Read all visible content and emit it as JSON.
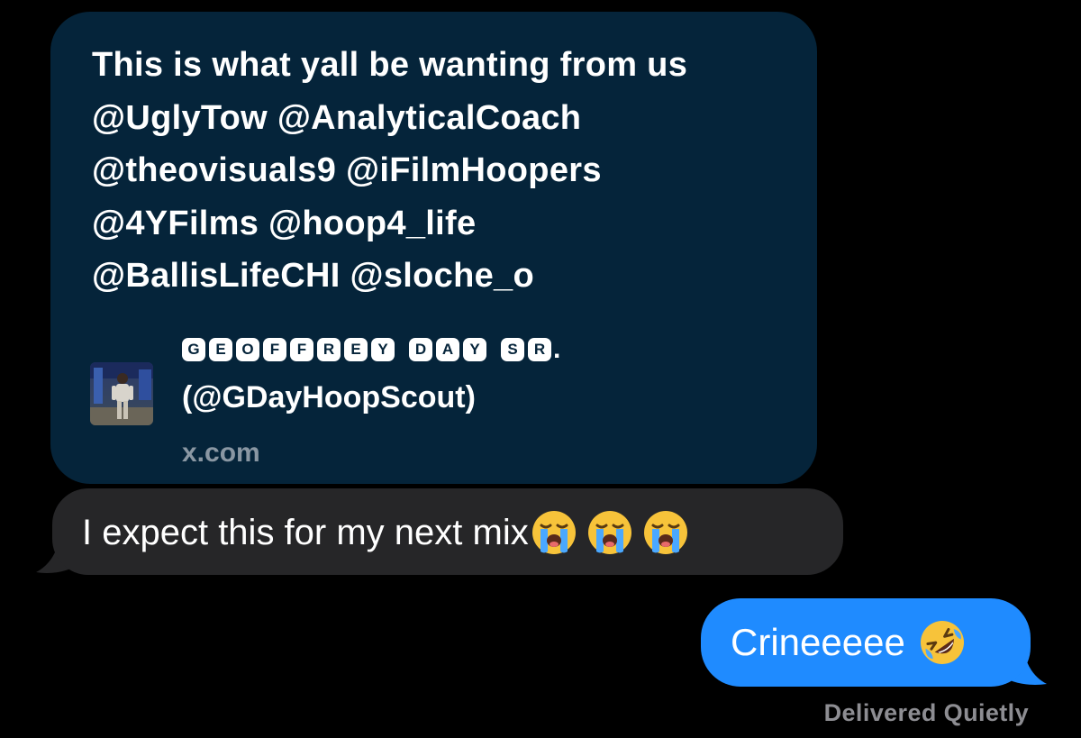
{
  "conversation": {
    "link_message": {
      "text_lines": [
        "This is what yall be wanting from us",
        "@UglyTow @AnalyticalCoach",
        "@theovisuals9 @iFilmHoopers",
        "@4YFilms @hoop4_life",
        "@BallisLifeCHI @sloche_o"
      ],
      "preview": {
        "author_name_letters": [
          [
            "G",
            "E",
            "O",
            "F",
            "F",
            "R",
            "E",
            "Y"
          ],
          [
            "D",
            "A",
            "Y"
          ],
          [
            "S",
            "R"
          ]
        ],
        "author_name_suffix": ".",
        "handle": "(@GDayHoopScout)",
        "domain": "x.com",
        "thumbnail_icon": "profile-photo"
      }
    },
    "incoming_message": {
      "text": "I expect this for my next mix",
      "emoji_icons": [
        "loudly-crying-face-icon",
        "loudly-crying-face-icon",
        "loudly-crying-face-icon"
      ]
    },
    "outgoing_message": {
      "text": "Crineeeee",
      "emoji_icon": "rolling-on-floor-laughing-icon"
    },
    "delivery_status": "Delivered Quietly"
  },
  "colors": {
    "background": "#000000",
    "link_bubble": "#05243a",
    "incoming_bubble": "#262628",
    "outgoing_bubble": "#1f8bff",
    "muted_text": "#8d8d92"
  }
}
